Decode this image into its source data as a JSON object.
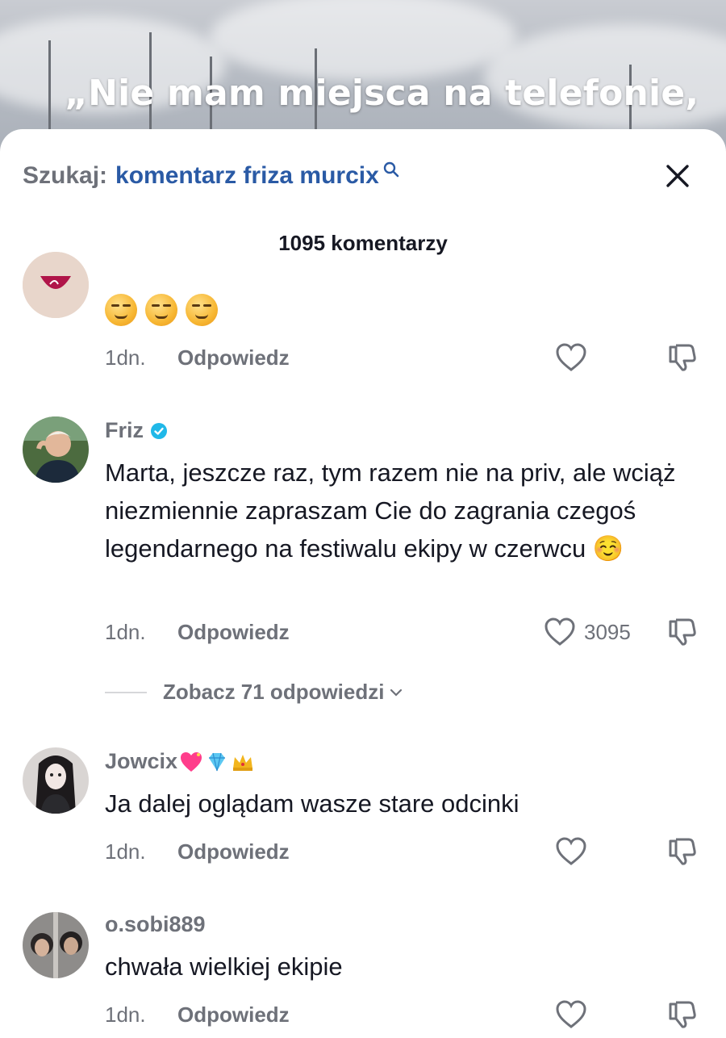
{
  "video": {
    "caption": "„Nie mam miejsca na telefonie,"
  },
  "search": {
    "prefix": "Szukaj:",
    "query": "komentarz friza murcix"
  },
  "comments_header": {
    "count_label": "1095 komentarzy"
  },
  "comments": [
    {
      "username": "",
      "text": "",
      "emoji_count": 3,
      "time": "1dn.",
      "reply_label": "Odpowiedz",
      "likes": ""
    },
    {
      "username": "Friz",
      "verified": true,
      "text": "Marta, jeszcze raz, tym razem nie na priv, ale wciąż niezmiennie zapraszam Cie do zagrania czegoś legendarnego na festiwalu ekipy w czerwcu ☺️",
      "time": "1dn.",
      "reply_label": "Odpowiedz",
      "likes": "3095",
      "view_replies_label": "Zobacz 71 odpowiedzi"
    },
    {
      "username": "Jowcix",
      "text": "Ja dalej oglądam wasze stare odcinki",
      "time": "1dn.",
      "reply_label": "Odpowiedz",
      "likes": ""
    },
    {
      "username": "o.sobi889",
      "text": "chwała wielkiej ekipie",
      "time": "1dn.",
      "reply_label": "Odpowiedz",
      "likes": ""
    }
  ],
  "icons": {
    "search": "search-icon",
    "close": "close-icon",
    "like": "heart-outline-icon",
    "dislike": "thumbs-down-icon",
    "verified": "verified-badge-icon",
    "chevron": "chevron-down-icon"
  },
  "colors": {
    "search_query": "#2a5aa5",
    "muted_text": "#6e7179",
    "verified": "#20b8e8"
  }
}
